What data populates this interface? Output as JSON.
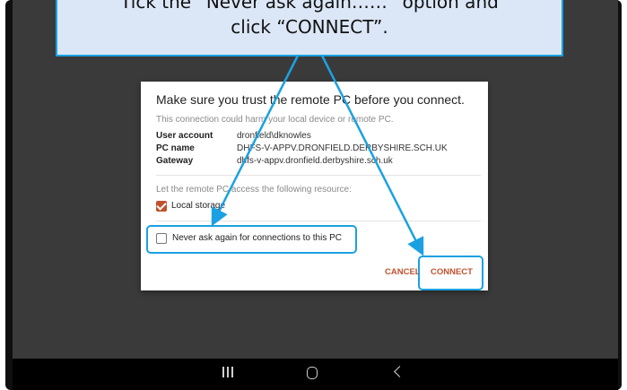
{
  "callout": {
    "line1": "Tick the “Never ask again……” option and",
    "line2": "click “CONNECT”."
  },
  "dialog": {
    "title": "Make sure you trust the remote PC before you connect.",
    "warning": "This connection could harm your local device or remote PC.",
    "details": [
      {
        "label": "User account",
        "value": "dronfield\\dknowles"
      },
      {
        "label": "PC name",
        "value": "DHFS-V-APPV.DRONFIELD.DERBYSHIRE.SCH.UK"
      },
      {
        "label": "Gateway",
        "value": "dhfs-v-appv.dronfield.derbyshire.sch.uk"
      }
    ],
    "resource_prompt": "Let the remote PC access the following resource:",
    "local_storage_label": "Local storage",
    "never_ask_label": "Never ask again for connections to this PC",
    "cancel_label": "CANCEL",
    "connect_label": "CONNECT"
  },
  "colors": {
    "accent": "#c0522d",
    "highlight": "#1ba1e2"
  },
  "icons": {
    "recents": "recents-icon",
    "home": "home-icon",
    "back": "back-icon"
  }
}
